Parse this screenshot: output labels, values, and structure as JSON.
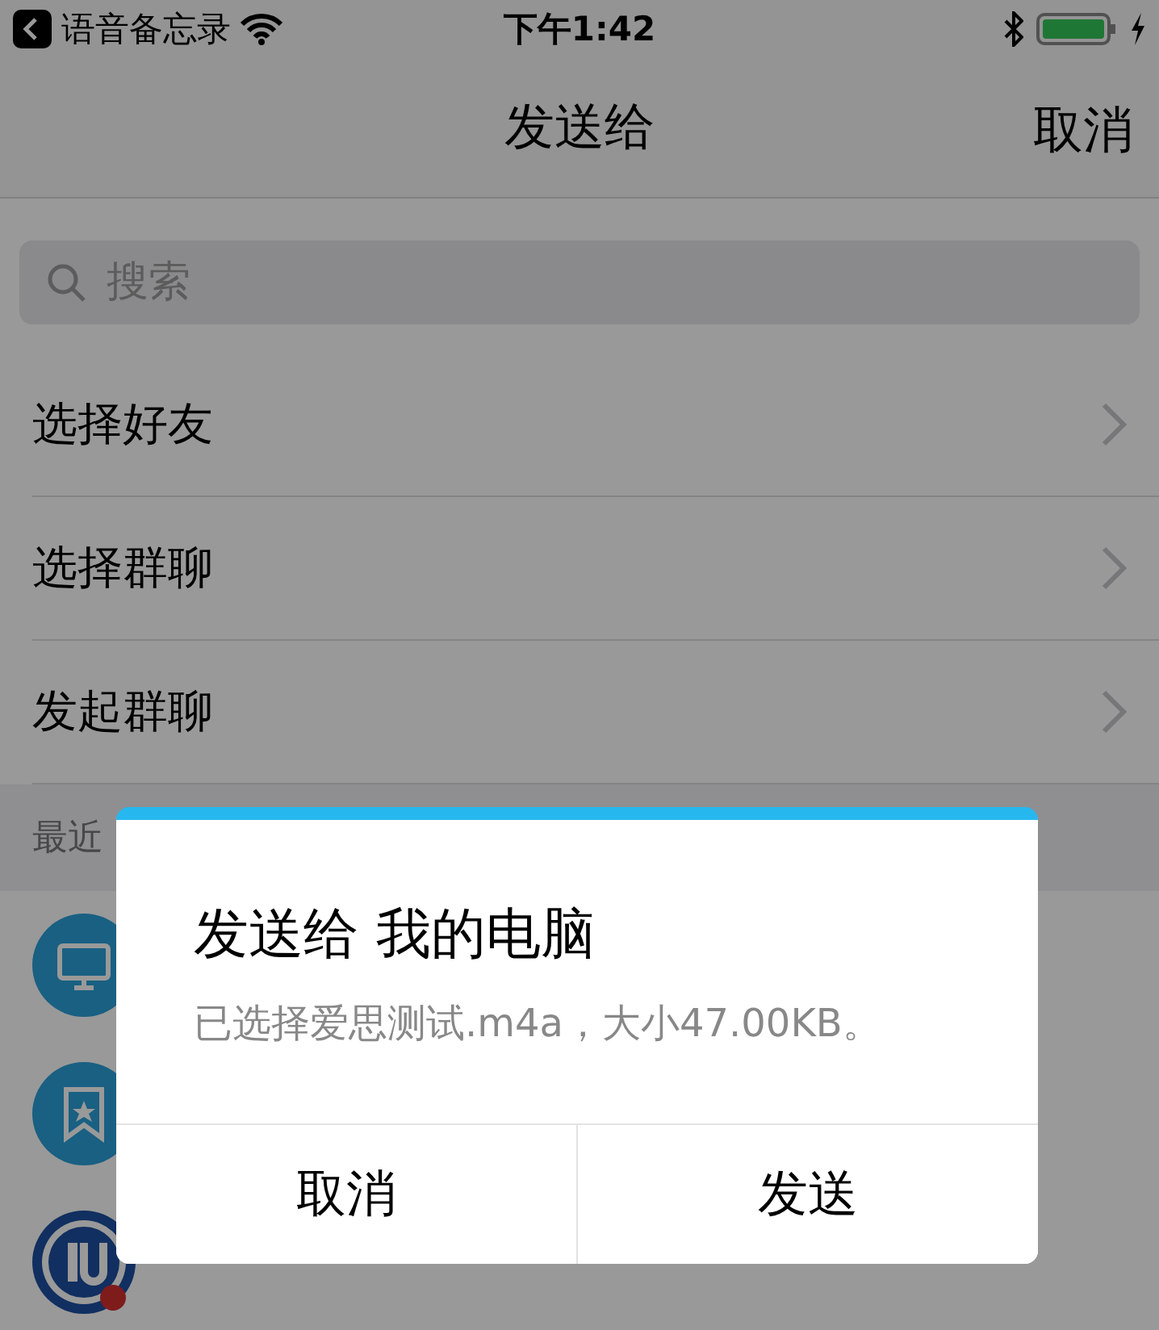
{
  "status_bar": {
    "back_app": "语音备忘录",
    "time": "下午1:42"
  },
  "nav": {
    "title": "发送给",
    "cancel": "取消"
  },
  "search": {
    "placeholder": "搜索"
  },
  "menu": [
    {
      "label": "选择好友"
    },
    {
      "label": "选择群聊"
    },
    {
      "label": "发起群聊"
    }
  ],
  "section": {
    "title": "最近"
  },
  "recent": [
    {
      "kind": "computer"
    },
    {
      "kind": "favorites"
    },
    {
      "kind": "logo"
    }
  ],
  "dialog": {
    "title": "发送给 我的电脑",
    "message": "已选择爱思测试.m4a，大小47.00KB。",
    "buttons": [
      "取消",
      "发送"
    ]
  }
}
